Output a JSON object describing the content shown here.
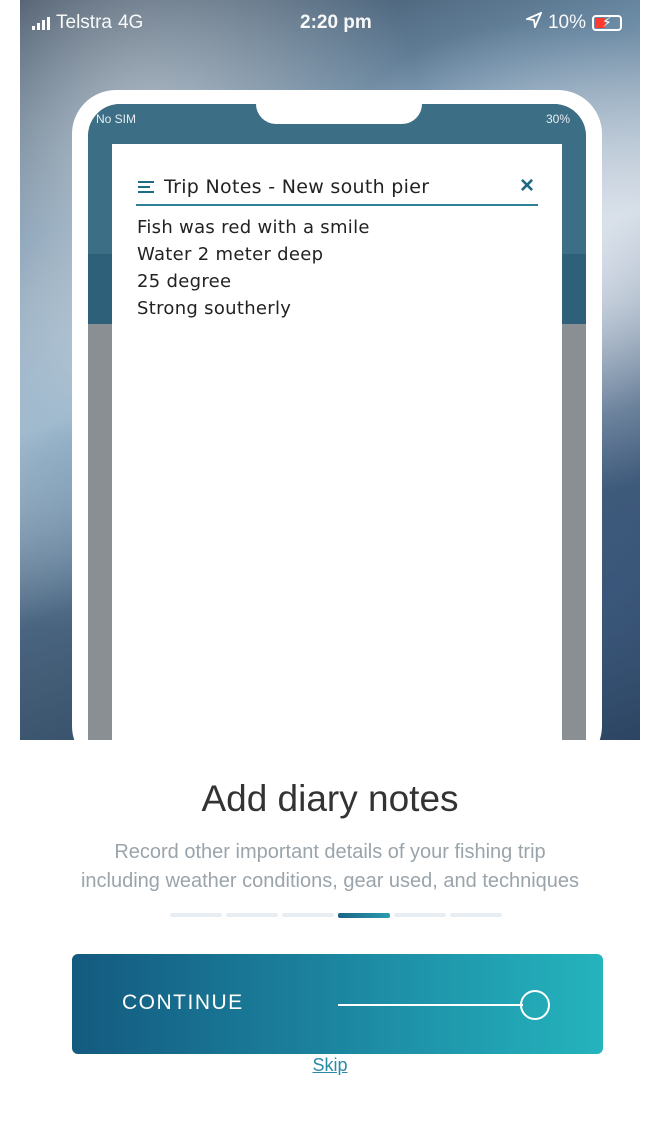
{
  "status_bar": {
    "carrier": "Telstra",
    "network": "4G",
    "time": "2:20 pm",
    "battery": "10%",
    "location_icon": "location-arrow-icon"
  },
  "inner_status_bar": {
    "carrier": "No SIM",
    "battery": "30%"
  },
  "notes_card": {
    "title": "Trip Notes - New south pier",
    "close_label": "×",
    "lines": [
      "Fish was red with a smile",
      "Water 2 meter deep",
      "25 degree",
      "Strong southerly"
    ]
  },
  "onboarding": {
    "title": "Add diary notes",
    "description_line1": "Record other important details of your fishing trip",
    "description_line2": "including weather conditions, gear used, and techniques",
    "pager": {
      "total": 6,
      "active_index": 3
    }
  },
  "actions": {
    "continue_label": "CONTINUE",
    "skip_label": "Skip"
  },
  "colors": {
    "accent": "#1f6a84",
    "button_start": "#135a7f",
    "button_end": "#24b4bd",
    "link": "#2a8aa6"
  }
}
